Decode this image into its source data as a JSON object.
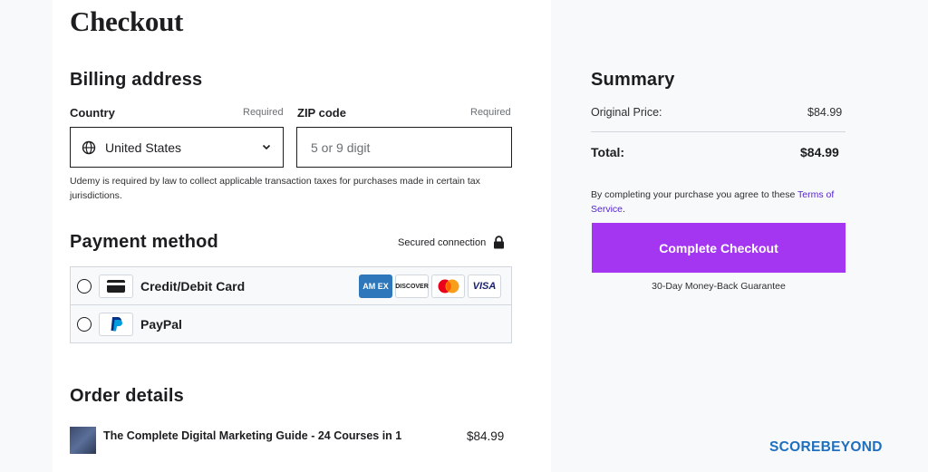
{
  "page": {
    "title": "Checkout"
  },
  "billing": {
    "heading": "Billing address",
    "country_label": "Country",
    "country_required": "Required",
    "country_value": "United States",
    "zip_label": "ZIP code",
    "zip_required": "Required",
    "zip_placeholder": "5 or 9 digit",
    "tax_note": "Udemy is required by law to collect applicable transaction taxes for purchases made in certain tax jurisdictions."
  },
  "payment": {
    "heading": "Payment method",
    "secured_text": "Secured connection",
    "methods": [
      {
        "label": "Credit/Debit Card",
        "icon": "credit-card-icon"
      },
      {
        "label": "PayPal",
        "icon": "paypal-icon"
      }
    ],
    "card_brands": {
      "amex": "AM EX",
      "discover": "DISCOVER",
      "visa": "VISA"
    }
  },
  "order": {
    "heading": "Order details",
    "items": [
      {
        "title": "The Complete Digital Marketing Guide - 24 Courses in 1",
        "price": "$84.99"
      }
    ]
  },
  "summary": {
    "heading": "Summary",
    "original_label": "Original Price:",
    "original_value": "$84.99",
    "total_label": "Total:",
    "total_value": "$84.99",
    "terms_prefix": "By completing your purchase you agree to these ",
    "terms_link": "Terms of Service",
    "terms_suffix": ".",
    "button_label": "Complete Checkout",
    "guarantee": "30-Day Money-Back Guarantee"
  },
  "watermark": {
    "part1": "SCORE",
    "part2": "BEYOND"
  },
  "colors": {
    "accent": "#a435f0",
    "link": "#5624d0",
    "brand": "#1e6fbf"
  }
}
